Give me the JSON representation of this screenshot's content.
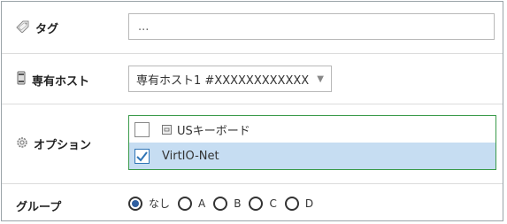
{
  "tag": {
    "label": "タグ",
    "icon": "tag-icon",
    "placeholder": "..."
  },
  "dedicated_host": {
    "label": "専有ホスト",
    "icon": "server-icon",
    "selected_value": "専有ホスト1 #XXXXXXXXXXXX"
  },
  "options": {
    "label": "オプション",
    "icon": "gear-icon",
    "items": [
      {
        "label": "USキーボード",
        "checked": false,
        "icon": "keyboard-icon"
      },
      {
        "label": "VirtIO-Net",
        "checked": true
      }
    ]
  },
  "group": {
    "label": "グループ",
    "options": [
      {
        "label": "なし",
        "selected": true
      },
      {
        "label": "A",
        "selected": false
      },
      {
        "label": "B",
        "selected": false
      },
      {
        "label": "C",
        "selected": false
      },
      {
        "label": "D",
        "selected": false
      }
    ]
  },
  "colors": {
    "accent_green": "#3a9a4a",
    "selection_blue": "#c6ddf2",
    "check_blue": "#2f74b5"
  }
}
